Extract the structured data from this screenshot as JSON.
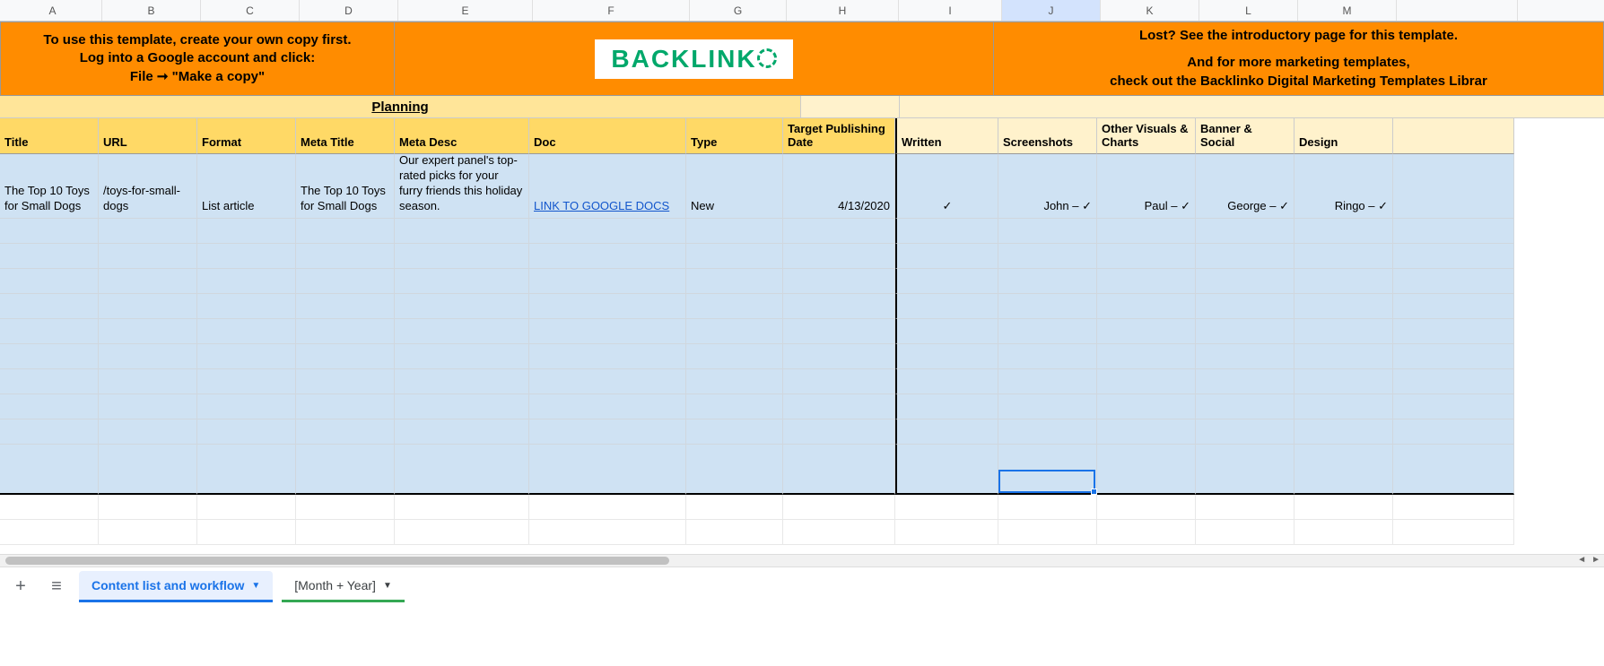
{
  "columns": [
    "A",
    "B",
    "C",
    "D",
    "E",
    "F",
    "G",
    "H",
    "I",
    "J",
    "K",
    "L",
    "M"
  ],
  "selected_column": "J",
  "banner": {
    "left_line1": "To use this template, create your own copy first.",
    "left_line2": "Log into a Google account and click:",
    "left_line3": "File ➞ \"Make a copy\"",
    "logo_text": "BACKLINK",
    "right_line1": "Lost? See the introductory page for this template.",
    "right_line2": "And for more marketing templates,",
    "right_line3": "check out the Backlinko Digital Marketing Templates Librar"
  },
  "section_title": "Planning",
  "headers": {
    "title": "Title",
    "url": "URL",
    "format": "Format",
    "meta_title": "Meta Title",
    "meta_desc": "Meta Desc",
    "doc": "Doc",
    "type": "Type",
    "target_date": "Target Publishing Date",
    "written": "Written",
    "screenshots": "Screenshots",
    "visuals": "Other Visuals & Charts",
    "banner": "Banner & Social",
    "design": "Design"
  },
  "row1": {
    "title": "The Top 10 Toys for Small Dogs",
    "url": "/toys-for-small-dogs",
    "format": "List article",
    "meta_title": "The Top 10 Toys for Small Dogs",
    "meta_desc": "Our expert panel's top-rated picks for your furry friends this holiday season.",
    "doc": "LINK TO GOOGLE DOCS",
    "type": "New",
    "target_date": "4/13/2020",
    "written": "✓",
    "screenshots": "John – ✓",
    "visuals": "Paul – ✓",
    "banner": "George –  ✓",
    "design": "Ringo – ✓"
  },
  "tabs": {
    "add": "+",
    "menu": "≡",
    "active": "Content list and workflow",
    "inactive": "[Month + Year]"
  }
}
